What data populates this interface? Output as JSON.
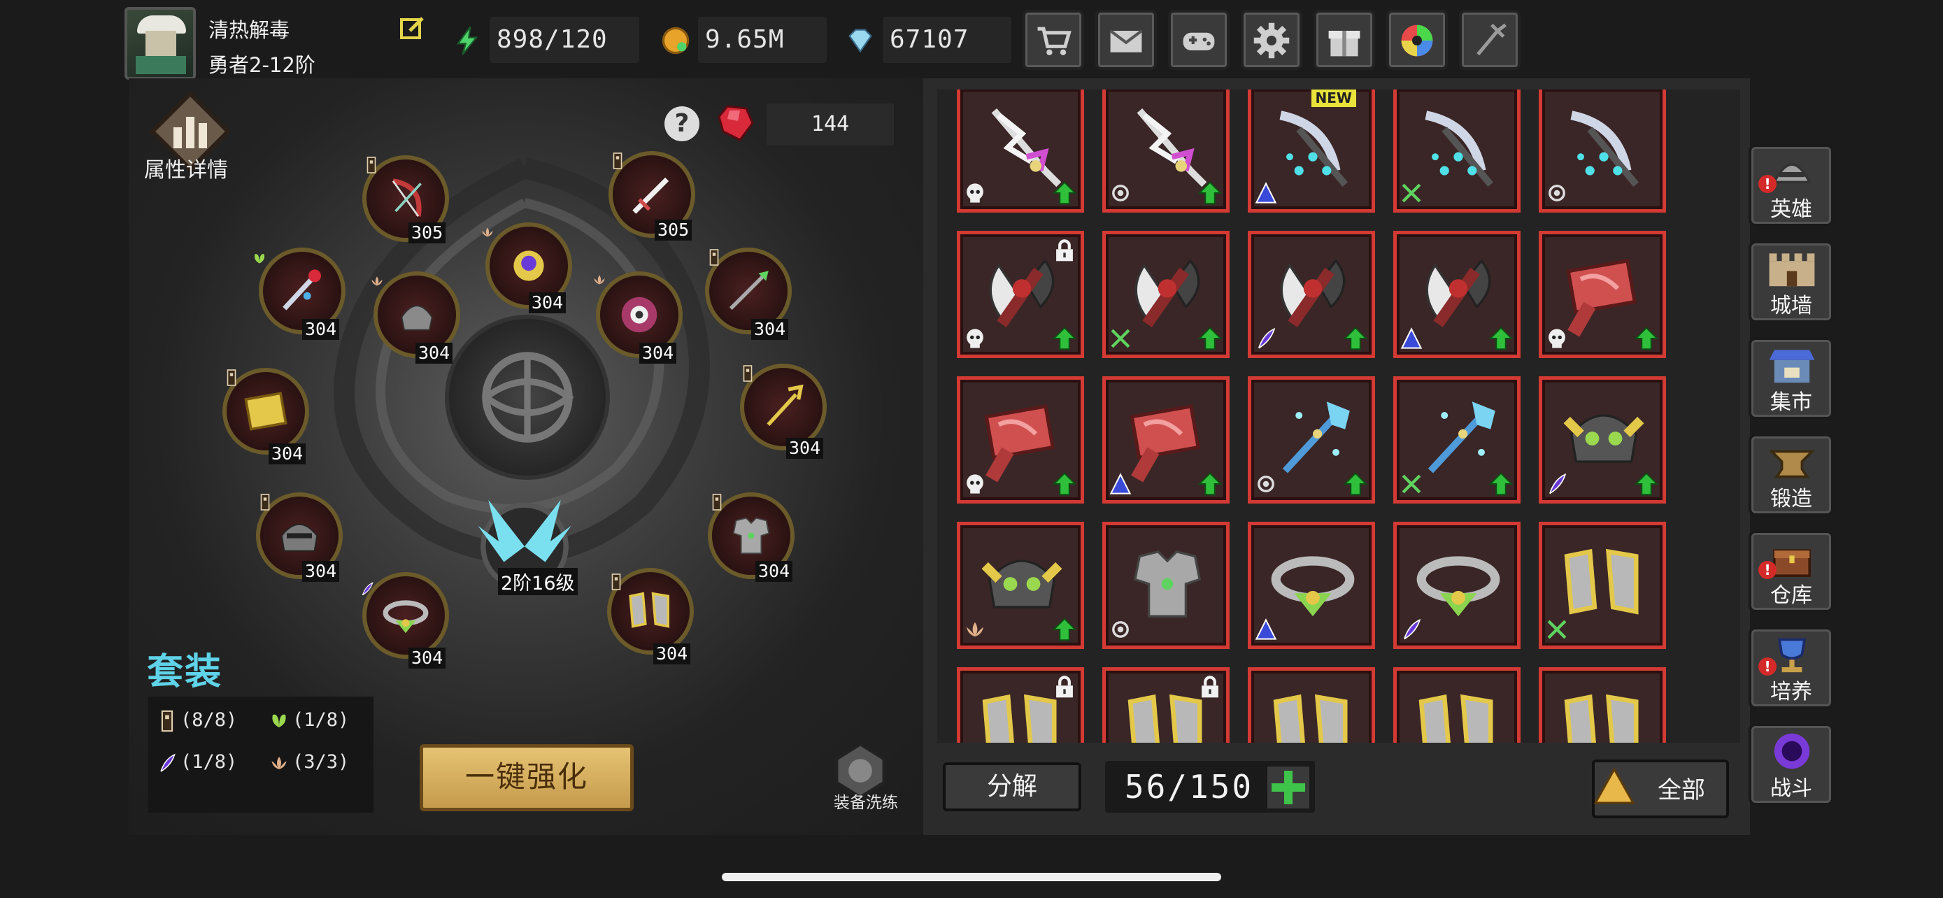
{
  "player": {
    "name": "清热解毒",
    "rank": "勇者2-12阶"
  },
  "resources": {
    "energy": "898/120",
    "gold": "9.65M",
    "diamonds": "67107"
  },
  "top_menu": [
    "cart-icon",
    "mail-icon",
    "gamepad-icon",
    "settings-icon",
    "gift-icon",
    "color-wheel-icon",
    "fireworks-icon"
  ],
  "attribute_button": {
    "label": "属性详情"
  },
  "gems": {
    "count": "144"
  },
  "equipment_slots": [
    {
      "name": "slot-bow",
      "level": "305"
    },
    {
      "name": "slot-sword",
      "level": "305"
    },
    {
      "name": "slot-staff",
      "level": "304"
    },
    {
      "name": "slot-helmet-small",
      "level": "304"
    },
    {
      "name": "slot-amulet",
      "level": "304"
    },
    {
      "name": "slot-shield",
      "level": "304"
    },
    {
      "name": "slot-spear",
      "level": "304"
    },
    {
      "name": "slot-book",
      "level": "304"
    },
    {
      "name": "slot-trident",
      "level": "304"
    },
    {
      "name": "slot-helmet",
      "level": "304"
    },
    {
      "name": "slot-armor",
      "level": "304"
    },
    {
      "name": "slot-necklace",
      "level": "304"
    },
    {
      "name": "slot-boots",
      "level": "304"
    }
  ],
  "wing": {
    "label": "2阶16级"
  },
  "set_bonus": {
    "title": "套装",
    "entries": [
      "(8/8)",
      "(1/8)",
      "(1/8)",
      "(3/3)"
    ]
  },
  "enhance_button": {
    "label": "一键强化"
  },
  "reforge": {
    "label": "装备洗练"
  },
  "inventory": {
    "new_tag": "NEW",
    "capacity": "56/150",
    "decompose_label": "分解",
    "filter_label": "全部"
  },
  "side_nav": [
    {
      "label": "英雄",
      "alert": "!"
    },
    {
      "label": "城墙",
      "alert": ""
    },
    {
      "label": "集市",
      "alert": ""
    },
    {
      "label": "锻造",
      "alert": ""
    },
    {
      "label": "仓库",
      "alert": "!"
    },
    {
      "label": "培养",
      "alert": "!"
    },
    {
      "label": "战斗",
      "alert": ""
    }
  ],
  "colors": {
    "accent_cyan": "#5fd3e8",
    "item_border": "#d33a34",
    "upgrade_green": "#2fbf3a"
  }
}
